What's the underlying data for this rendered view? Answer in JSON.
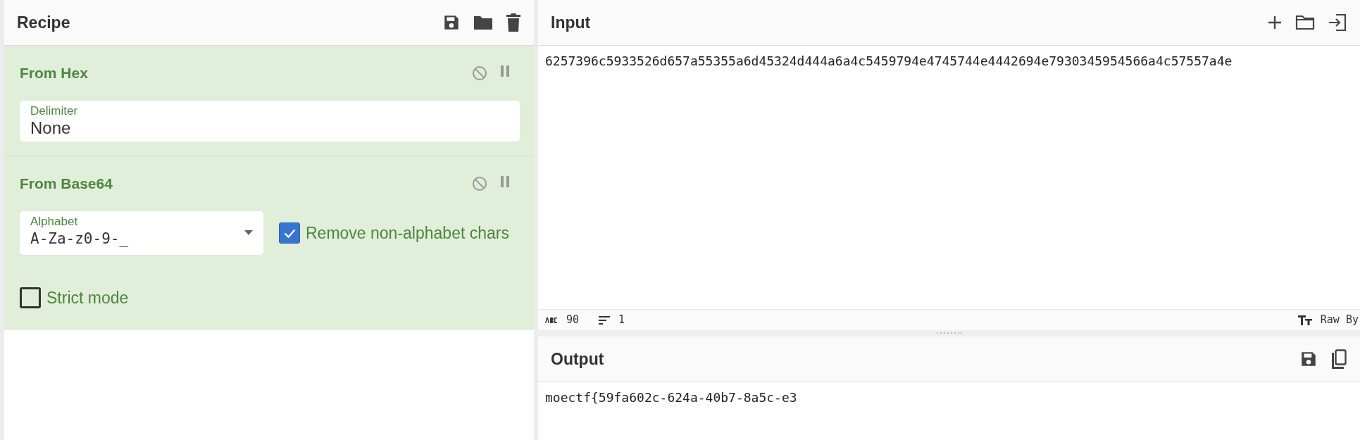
{
  "recipe": {
    "title": "Recipe",
    "operations": [
      {
        "name": "From Hex",
        "args": [
          {
            "kind": "text",
            "label": "Delimiter",
            "value": "None"
          }
        ]
      },
      {
        "name": "From Base64",
        "args": [
          {
            "kind": "dropdown",
            "label": "Alphabet",
            "value": "A-Za-z0-9-_"
          },
          {
            "kind": "checkbox",
            "label": "Remove non-alphabet chars",
            "checked": true
          },
          {
            "kind": "checkbox",
            "label": "Strict mode",
            "checked": false
          }
        ]
      }
    ]
  },
  "input": {
    "title": "Input",
    "text": "6257396c5933526d657a55355a6d45324d444a6a4c5459794e4745744e4442694e7930345954566a4c57557a4e",
    "status": {
      "length": "90",
      "lines": "1",
      "format": "Raw By"
    }
  },
  "output": {
    "title": "Output",
    "text": "moectf{59fa602c-624a-40b7-8a5c-e3"
  }
}
